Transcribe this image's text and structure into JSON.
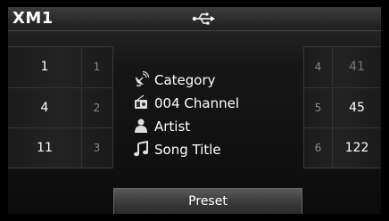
{
  "header": {
    "band": "XM1",
    "usb_icon": "usb-icon"
  },
  "presets_left": [
    {
      "channel": "1",
      "number": "1"
    },
    {
      "channel": "4",
      "number": "2"
    },
    {
      "channel": "11",
      "number": "3"
    }
  ],
  "presets_right": [
    {
      "number": "4",
      "channel": "41"
    },
    {
      "number": "5",
      "channel": "45"
    },
    {
      "number": "6",
      "channel": "122"
    }
  ],
  "info": {
    "category": "Category",
    "channel": "004 Channel",
    "artist": "Artist",
    "song": "Song Title"
  },
  "buttons": {
    "preset": "Preset"
  },
  "colors": {
    "background": "#0c0c0c",
    "text": "#ffffff",
    "dim_text": "#777777"
  }
}
